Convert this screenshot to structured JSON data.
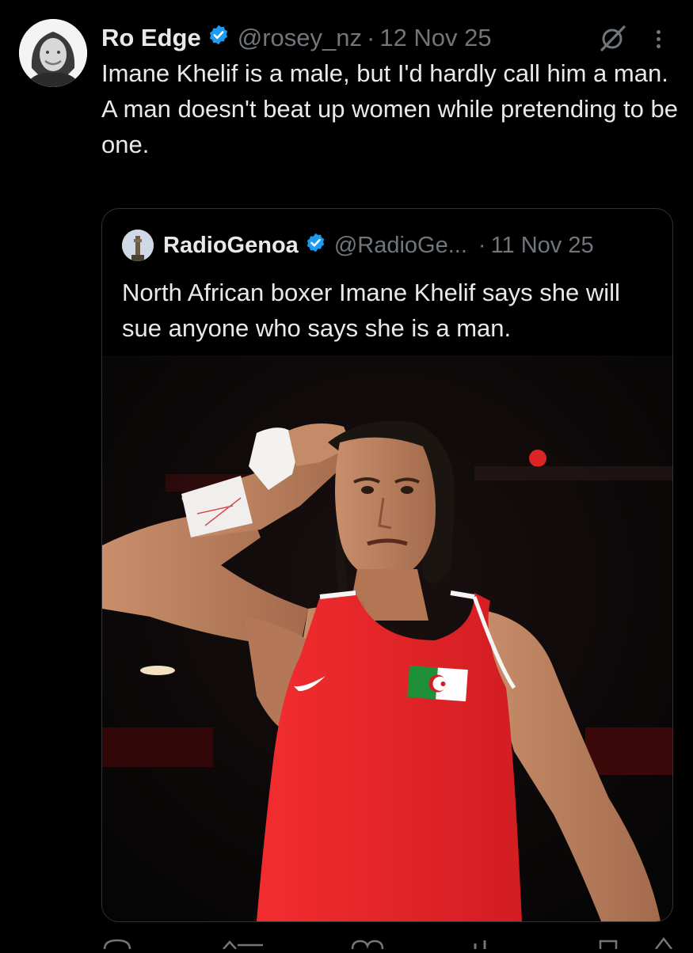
{
  "tweet": {
    "author_name": "Ro Edge",
    "handle": "@rosey_nz",
    "separator": "·",
    "date": "12 Nov 25",
    "text": "Imane Khelif is a male, but I'd hardly call him a man.\nA man doesn't beat up women while pretending to be one."
  },
  "quoted_tweet": {
    "author_name": "RadioGenoa",
    "handle": "@RadioGe...",
    "separator": "·",
    "date": "11 Nov 25",
    "text": "North African boxer Imane Khelif says she will sue anyone who says she is a man."
  },
  "icons": {
    "verified": "verified-badge-icon",
    "grok": "grok-icon",
    "more": "more-dots-icon",
    "reply": "reply-icon",
    "retweet": "retweet-icon",
    "like": "like-icon",
    "views": "views-icon",
    "bookmark": "bookmark-icon"
  },
  "colors": {
    "background": "#000000",
    "text": "#e7e9ea",
    "muted": "#71767b",
    "verified": "#1d9bf0",
    "border": "#2f3336",
    "jersey": "#e8262a"
  }
}
